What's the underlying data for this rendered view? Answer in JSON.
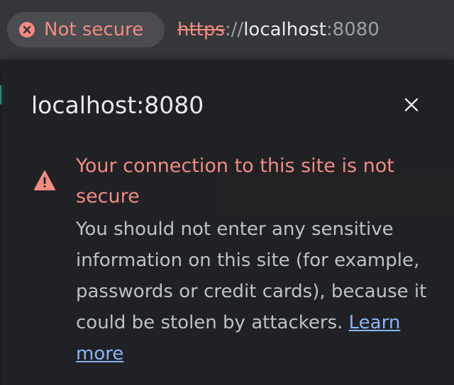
{
  "address_bar": {
    "security_chip": {
      "label": "Not secure",
      "icon": "error-circle-icon",
      "color": "#f28b82"
    },
    "url": {
      "scheme": "https",
      "separator": "://",
      "host": "localhost",
      "port": ":8080"
    }
  },
  "popup": {
    "title": "localhost:8080",
    "close_icon": "close-icon",
    "warning_icon": "warning-triangle-icon",
    "heading": "Your connection to this site is not secure",
    "body": "You should not enter any sensitive information on this site (for example, passwords or credit cards), because it could be stolen by attackers.",
    "learn_more": "Learn more",
    "link_color": "#8ab4f8"
  }
}
